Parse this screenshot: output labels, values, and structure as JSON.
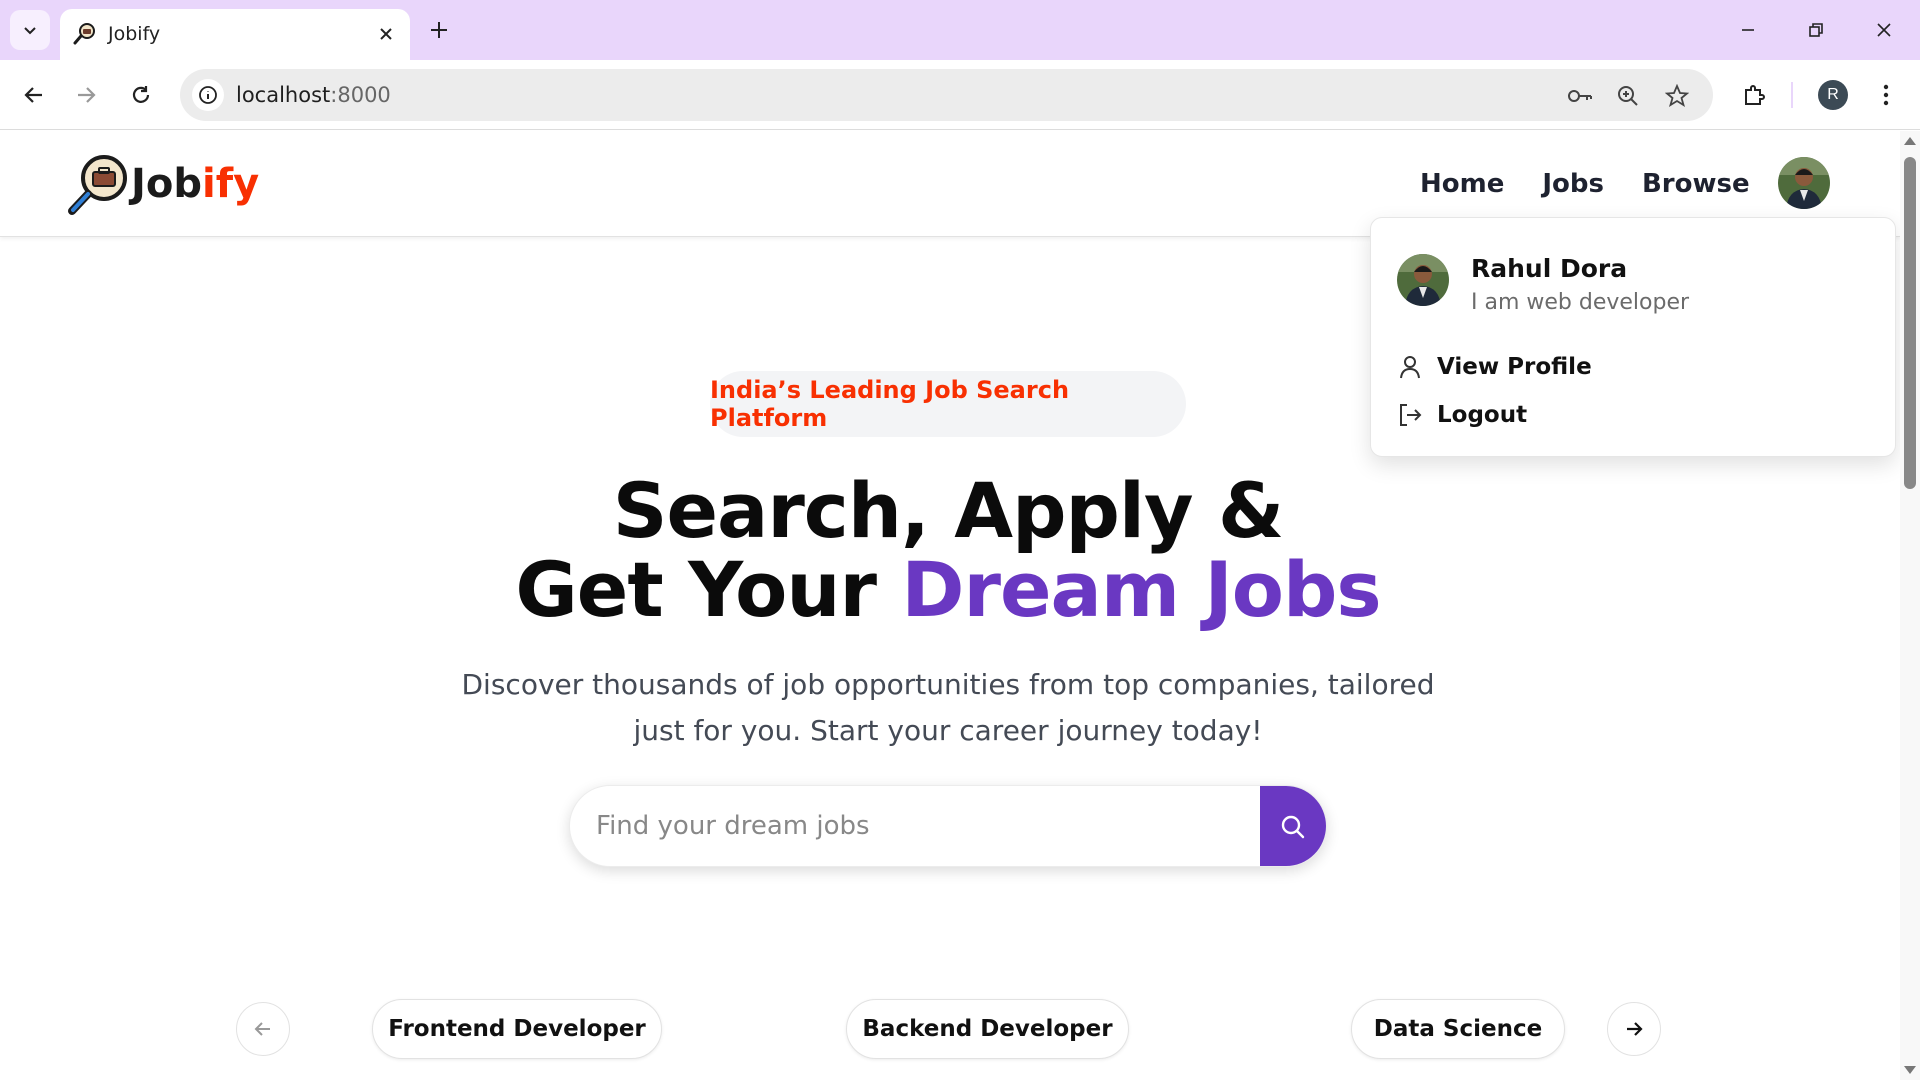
{
  "browser": {
    "tab_title": "Jobify",
    "url_host": "localhost",
    "url_port": ":8000",
    "profile_initial": "R",
    "accent": "#e9d6fb"
  },
  "site": {
    "logo_part1": "Job",
    "logo_part2": "ify",
    "nav": {
      "home": "Home",
      "jobs": "Jobs",
      "browse": "Browse"
    }
  },
  "profile_menu": {
    "name": "Rahul Dora",
    "bio": "I am web developer",
    "view_profile": "View Profile",
    "logout": "Logout"
  },
  "hero": {
    "badge": "India’s Leading Job Search Platform",
    "title_line1": "Search, Apply &",
    "title_line2_prefix": "Get Your ",
    "title_line2_highlight": "Dream Jobs",
    "subtitle": "Discover thousands of job opportunities from top companies, tailored just for you. Start your career journey today!",
    "search_placeholder": "Find your dream jobs"
  },
  "categories": [
    "Frontend Developer",
    "Backend Developer",
    "Data Science"
  ],
  "colors": {
    "brand_red": "#f83002",
    "brand_purple": "#6a38c2"
  }
}
